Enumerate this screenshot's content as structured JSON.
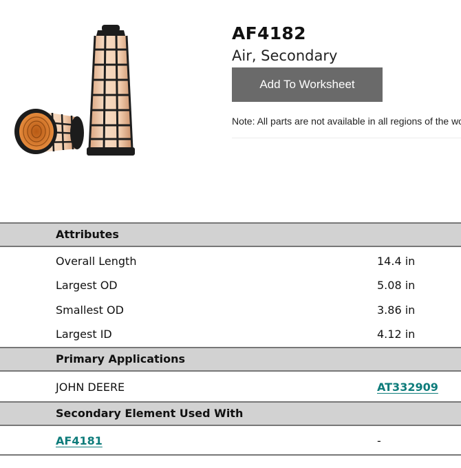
{
  "product": {
    "part_number": "AF4182",
    "description": "Air, Secondary",
    "add_button_label": "Add To Worksheet",
    "note": "Note: All parts are not available in all regions of the world."
  },
  "attributes": {
    "title": "Attributes",
    "rows": [
      {
        "label": "Overall Length",
        "value": "14.4 in"
      },
      {
        "label": "Largest OD",
        "value": "5.08 in"
      },
      {
        "label": "Smallest OD",
        "value": "3.86 in"
      },
      {
        "label": "Largest ID",
        "value": "4.12 in"
      }
    ]
  },
  "primary_applications": {
    "title": "Primary Applications",
    "rows": [
      {
        "manufacturer": "JOHN DEERE",
        "part": "AT332909"
      }
    ]
  },
  "secondary_element": {
    "title": "Secondary Element Used With",
    "rows": [
      {
        "part": "AF4181",
        "value": "-"
      }
    ]
  },
  "colors": {
    "link": "#0e7c7b",
    "button_bg": "#6a6a6a",
    "header_bg": "#d2d2d2",
    "filter_media": "#f1c9a6",
    "filter_frame": "#1c1c1c",
    "filter_inner": "#d9782e"
  }
}
